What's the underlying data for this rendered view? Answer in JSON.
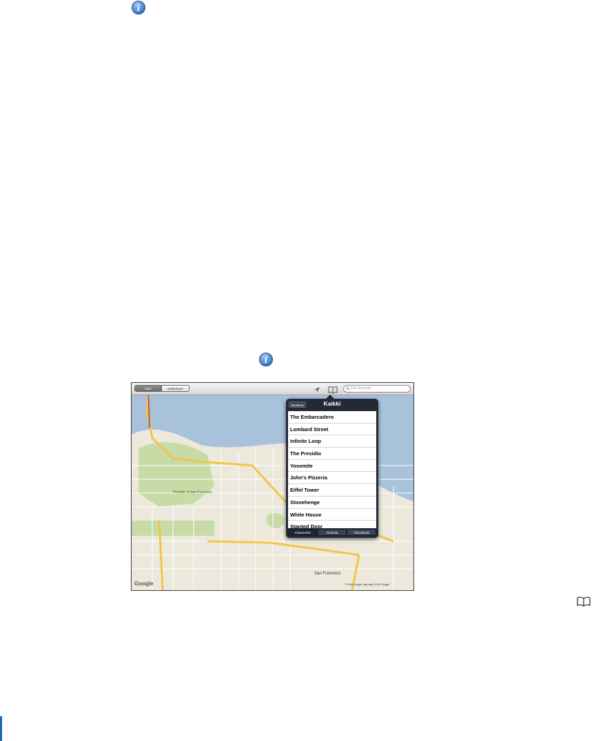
{
  "map_app": {
    "toolbar": {
      "search_tab": "Haku",
      "directions_tab": "Reittiohjeet",
      "search_placeholder": "Etsi tai osoite"
    },
    "popover": {
      "done_button": "Muokkaa",
      "title": "Kaikki",
      "items": [
        {
          "label": "The Embarcadero"
        },
        {
          "label": "Lombard Street"
        },
        {
          "label": "Infinite Loop"
        },
        {
          "label": "The Presidio"
        },
        {
          "label": "Yosemite"
        },
        {
          "label": "John's Pizzeria"
        },
        {
          "label": "Eiffel Tower"
        },
        {
          "label": "Stonehenge"
        },
        {
          "label": "White House"
        },
        {
          "label": "Stanted Door"
        }
      ],
      "tabs": {
        "bookmarks": "Kirjanmerkit",
        "recents": "Aiemmat",
        "contacts": "Yhteystiedot"
      }
    },
    "map": {
      "labels": {
        "district_1": "Presidio of San Francisco",
        "district_2": "San Francisco",
        "logo": "Google"
      },
      "copyright": "© 2010 Google, Map data ©2010 Google"
    }
  },
  "icons": {
    "info": "info-icon",
    "bookmark": "bookmark-icon",
    "location": "location-arrow-icon",
    "search": "search-icon"
  },
  "colors": {
    "water": "#a9c2dc",
    "park": "#c7dba6",
    "land": "#ece8dc",
    "highway": "#f2c547",
    "popover": "#232a36",
    "accent_rule": "#1a66b3"
  }
}
